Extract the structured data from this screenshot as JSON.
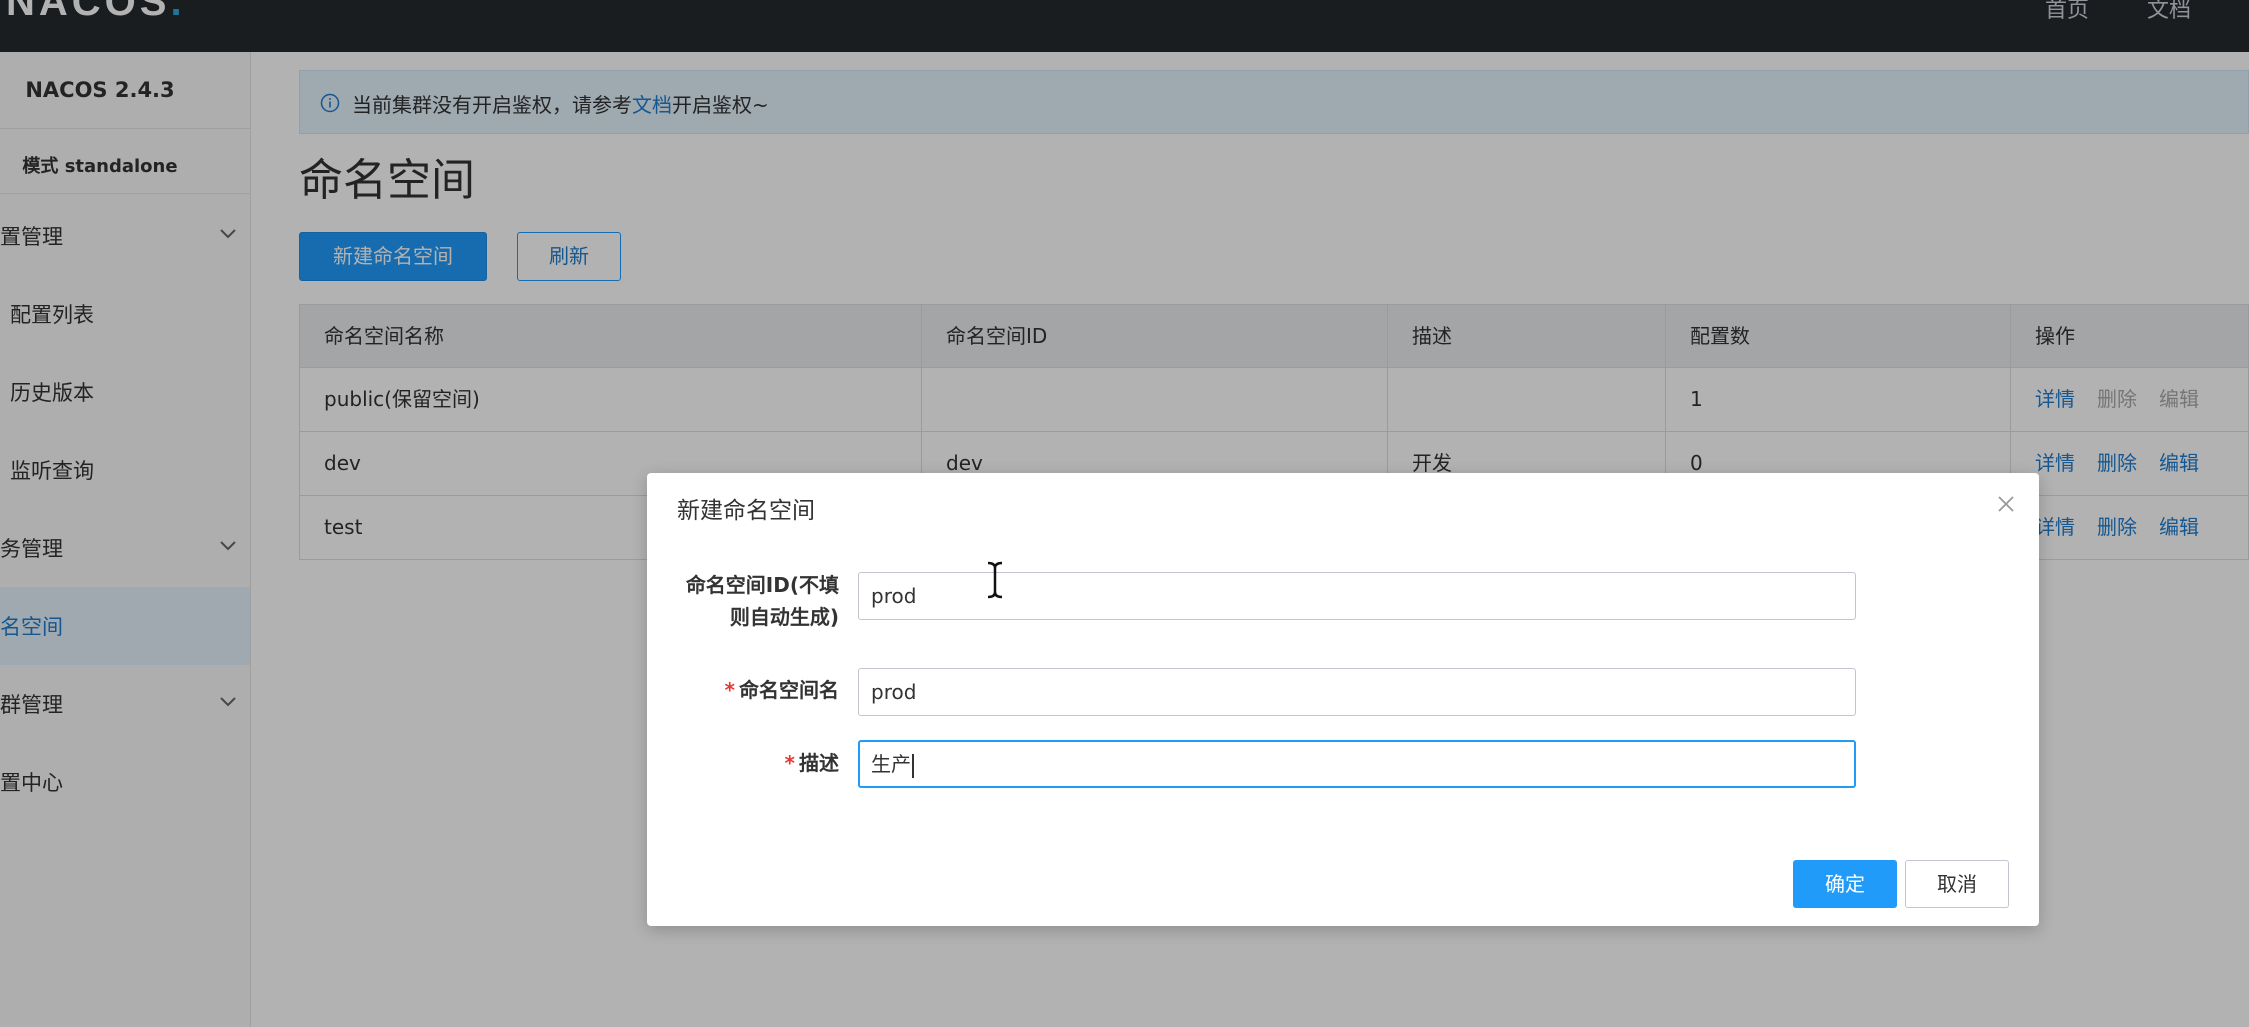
{
  "header": {
    "logo_text": "NACOS",
    "logo_dot": ".",
    "nav": [
      "首页",
      "文档"
    ]
  },
  "sidebar": {
    "version": "NACOS 2.4.3",
    "mode": "模式 standalone",
    "items": [
      {
        "label": "配置管理",
        "expandable": true
      },
      {
        "label": "配置列表",
        "sub": true
      },
      {
        "label": "历史版本",
        "sub": true
      },
      {
        "label": "监听查询",
        "sub": true
      },
      {
        "label": "服务管理",
        "expandable": true
      },
      {
        "label": "命名空间",
        "active": true
      },
      {
        "label": "集群管理",
        "expandable": true
      },
      {
        "label": "配置中心"
      }
    ]
  },
  "notice": {
    "before": "当前集群没有开启鉴权，请参考",
    "link": "文档",
    "after": "开启鉴权~"
  },
  "page": {
    "title": "命名空间",
    "new_button": "新建命名空间",
    "refresh_button": "刷新"
  },
  "table": {
    "headers": [
      "命名空间名称",
      "命名空间ID",
      "描述",
      "配置数",
      "操作"
    ],
    "rows": [
      {
        "name": "public(保留空间)",
        "id": "",
        "desc": "",
        "count": "1",
        "actions": [
          "详情",
          "删除",
          "编辑"
        ]
      },
      {
        "name": "dev",
        "id": "dev",
        "desc": "开发",
        "count": "0",
        "actions": [
          "详情",
          "删除",
          "编辑"
        ]
      },
      {
        "name": "test",
        "id": "",
        "desc": "",
        "count": "",
        "actions": [
          "详情",
          "删除",
          "编辑"
        ]
      }
    ]
  },
  "dialog": {
    "title": "新建命名空间",
    "id_label_line1": "命名空间ID(不填",
    "id_label_line2": "则自动生成)",
    "id_value": "prod",
    "name_label": "命名空间名",
    "name_value": "prod",
    "desc_label": "描述",
    "desc_value": "生产",
    "required_mark": "*",
    "ok_button": "确定",
    "cancel_button": "取消"
  },
  "colors": {
    "accent": "#209bfa",
    "link": "#1f7fd0",
    "topbar": "#252a2f",
    "required": "#e53935"
  },
  "icons": [
    "info-icon",
    "chevron-down-icon",
    "close-icon",
    "text-cursor-icon"
  ]
}
